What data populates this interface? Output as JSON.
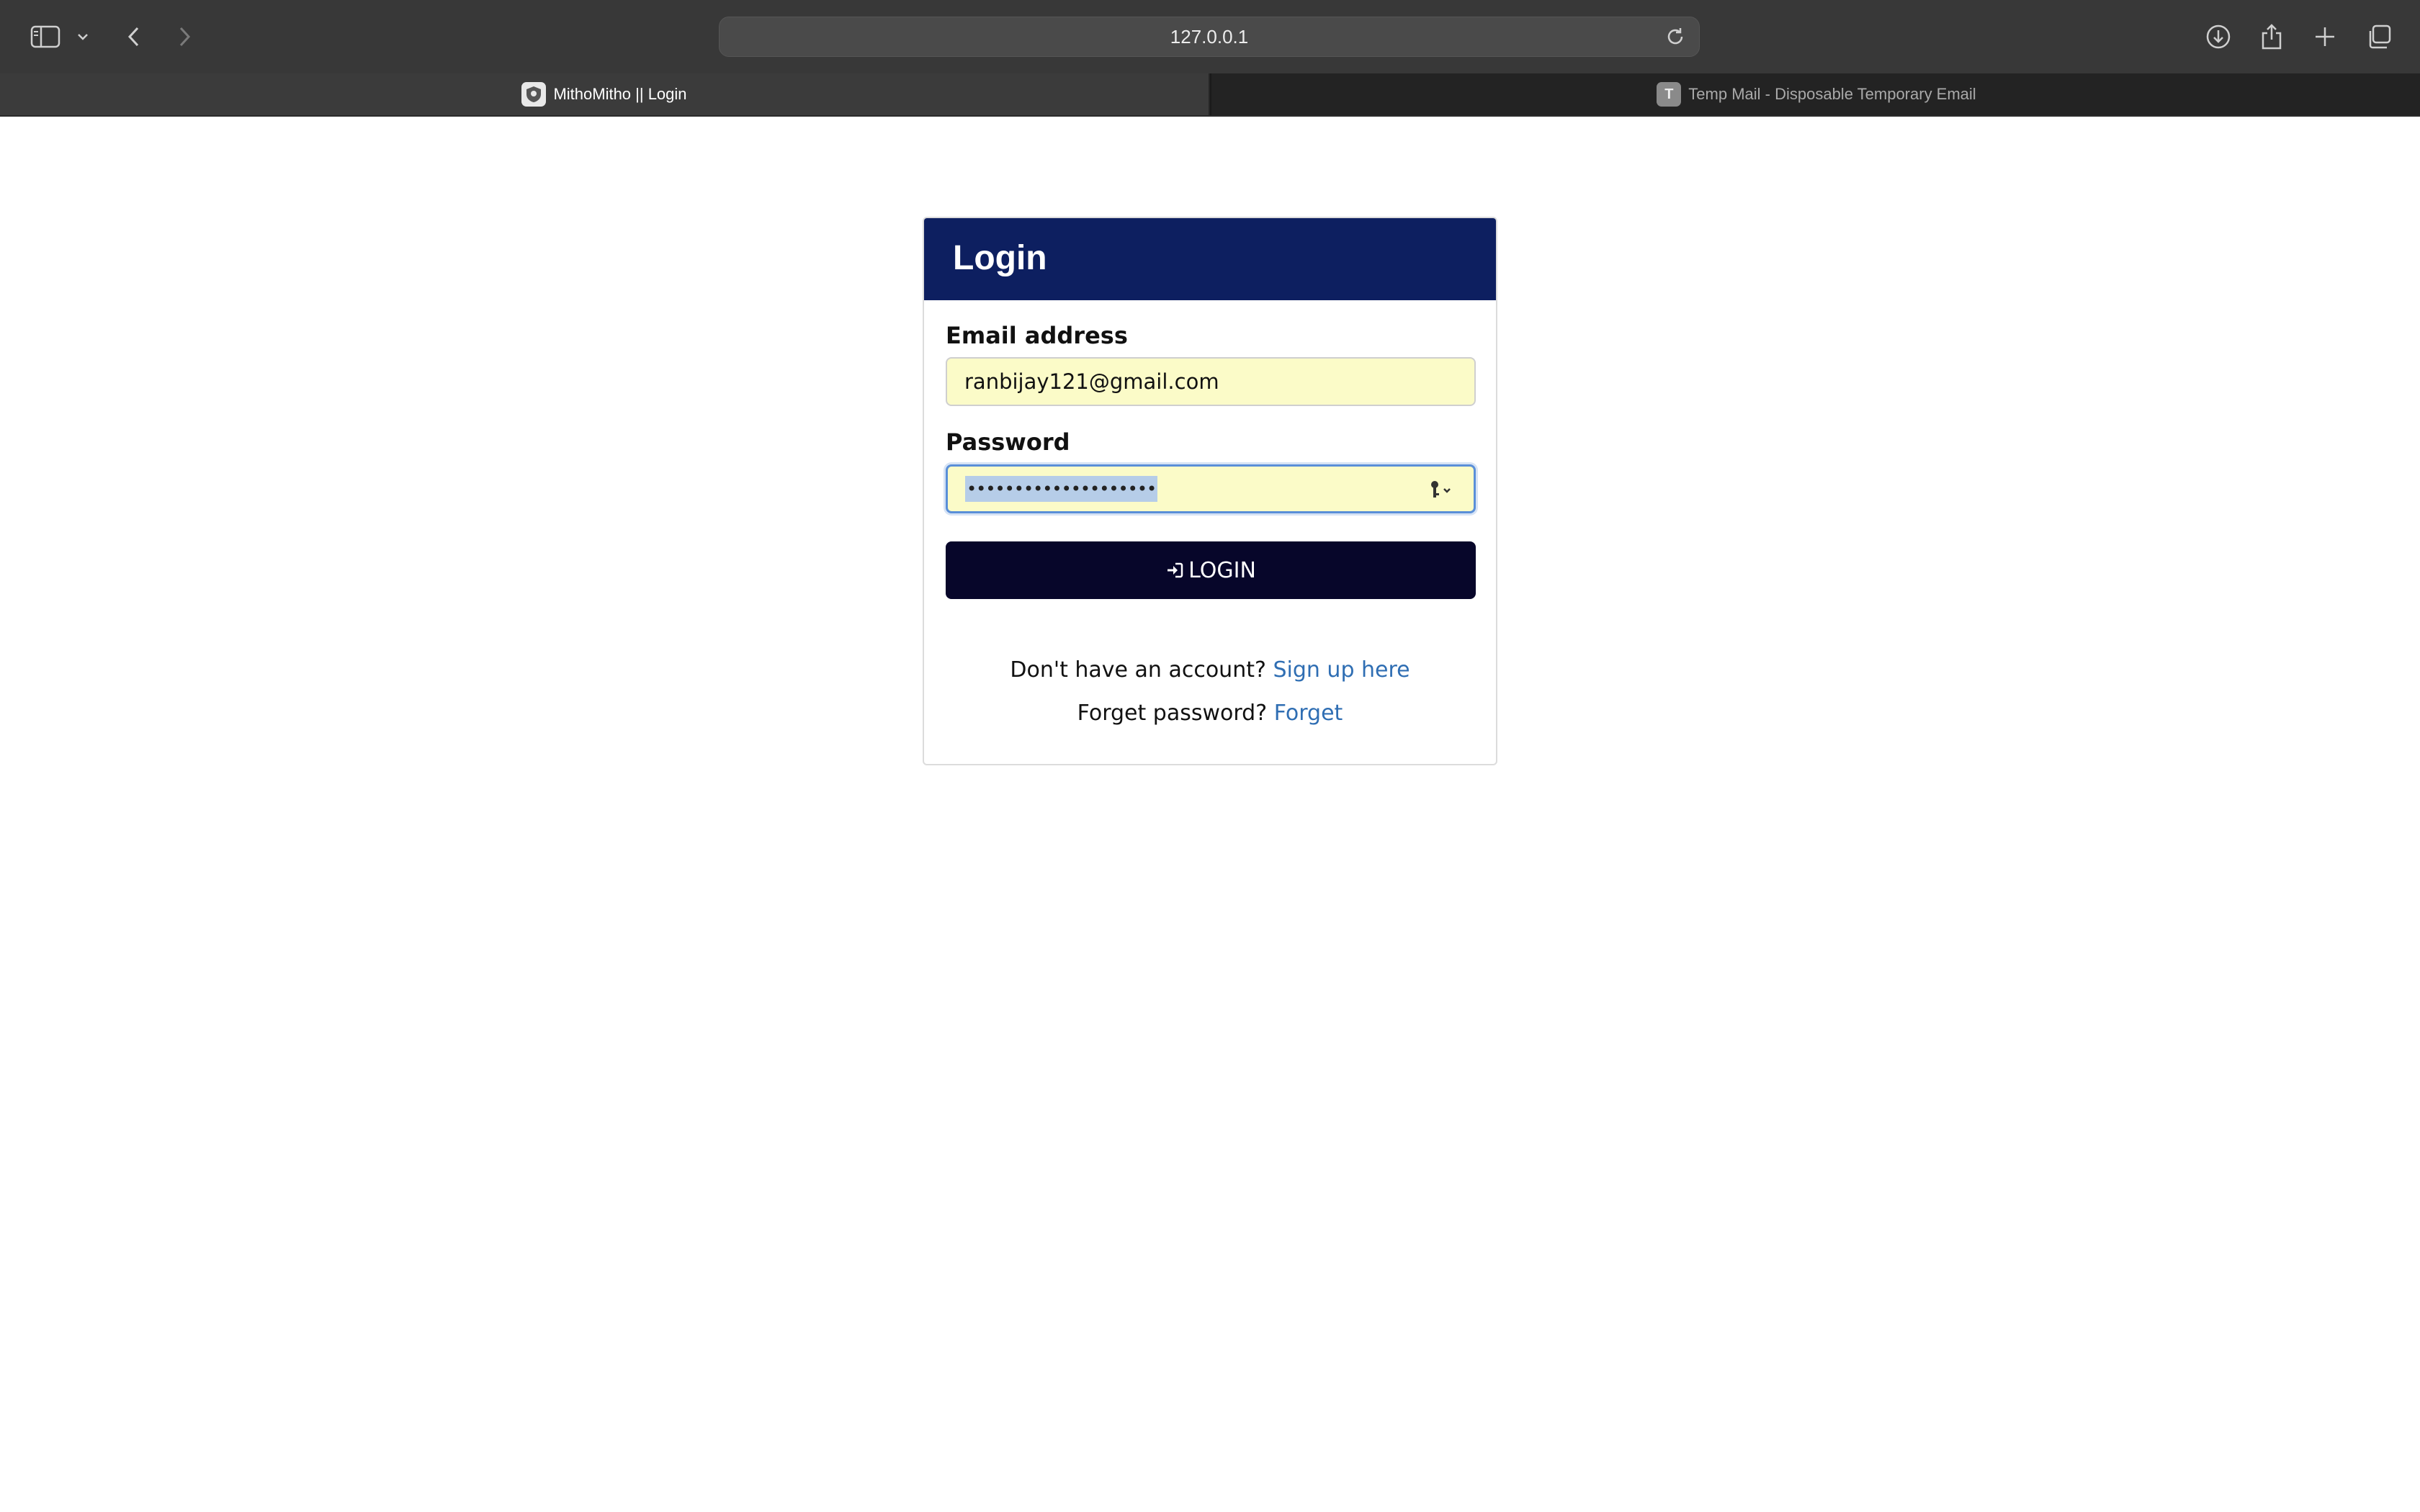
{
  "browser": {
    "url": "127.0.0.1",
    "tabs": [
      {
        "title": "MithoMitho || Login",
        "active": true,
        "favicon": "shield-icon"
      },
      {
        "title": "Temp Mail - Disposable Temporary Email",
        "active": false,
        "favicon_letter": "T"
      }
    ]
  },
  "login": {
    "title": "Login",
    "email_label": "Email address",
    "email_value": "ranbijay121@gmail.com",
    "password_label": "Password",
    "password_mask": "••••••••••••••••••••",
    "button_label": "LOGIN",
    "signup_prompt": "Don't have an account?",
    "signup_link": "Sign up here",
    "forget_prompt": "Forget password?",
    "forget_link": "Forget"
  },
  "colors": {
    "header_bg": "#0d1f60",
    "button_bg": "#07062a",
    "link": "#2f6eb3",
    "autofill_bg": "#fbfbc8"
  }
}
